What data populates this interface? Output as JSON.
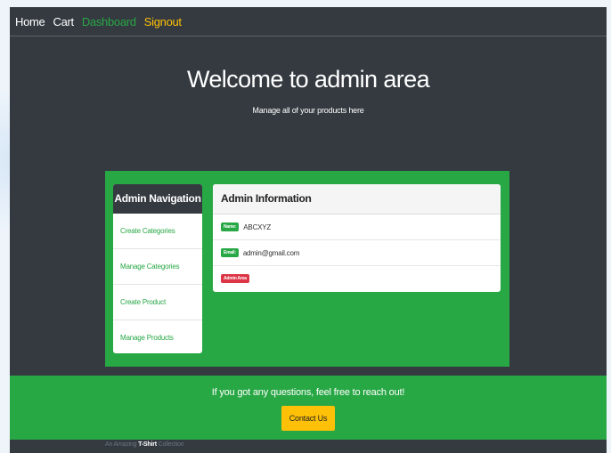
{
  "navbar": {
    "links": {
      "home": "Home",
      "cart": "Cart",
      "dashboard": "Dashboard",
      "signout": "Signout"
    }
  },
  "jumbotron": {
    "title": "Welcome to admin area",
    "subtitle": "Manage all of your products here"
  },
  "admin_nav": {
    "header": "Admin Navigation",
    "items": [
      "Create Categories",
      "Manage Categories",
      "Create Product",
      "Manage Products"
    ]
  },
  "admin_info": {
    "header": "Admin Information",
    "name_badge": "Name:",
    "name_value": "ABCXYZ",
    "email_badge": "Email:",
    "email_value": "admin@gmail.com",
    "area_badge": "Admin Area"
  },
  "footer": {
    "message": "If you got any questions, feel free to reach out!",
    "contact_label": "Contact Us",
    "tagline_pre": "An Amazing",
    "tagline_strong": "T-Shirt",
    "tagline_post": "Collection"
  },
  "colors": {
    "dark": "#343a40",
    "success": "#28a745",
    "warning": "#ffc107",
    "danger": "#dc3545"
  }
}
